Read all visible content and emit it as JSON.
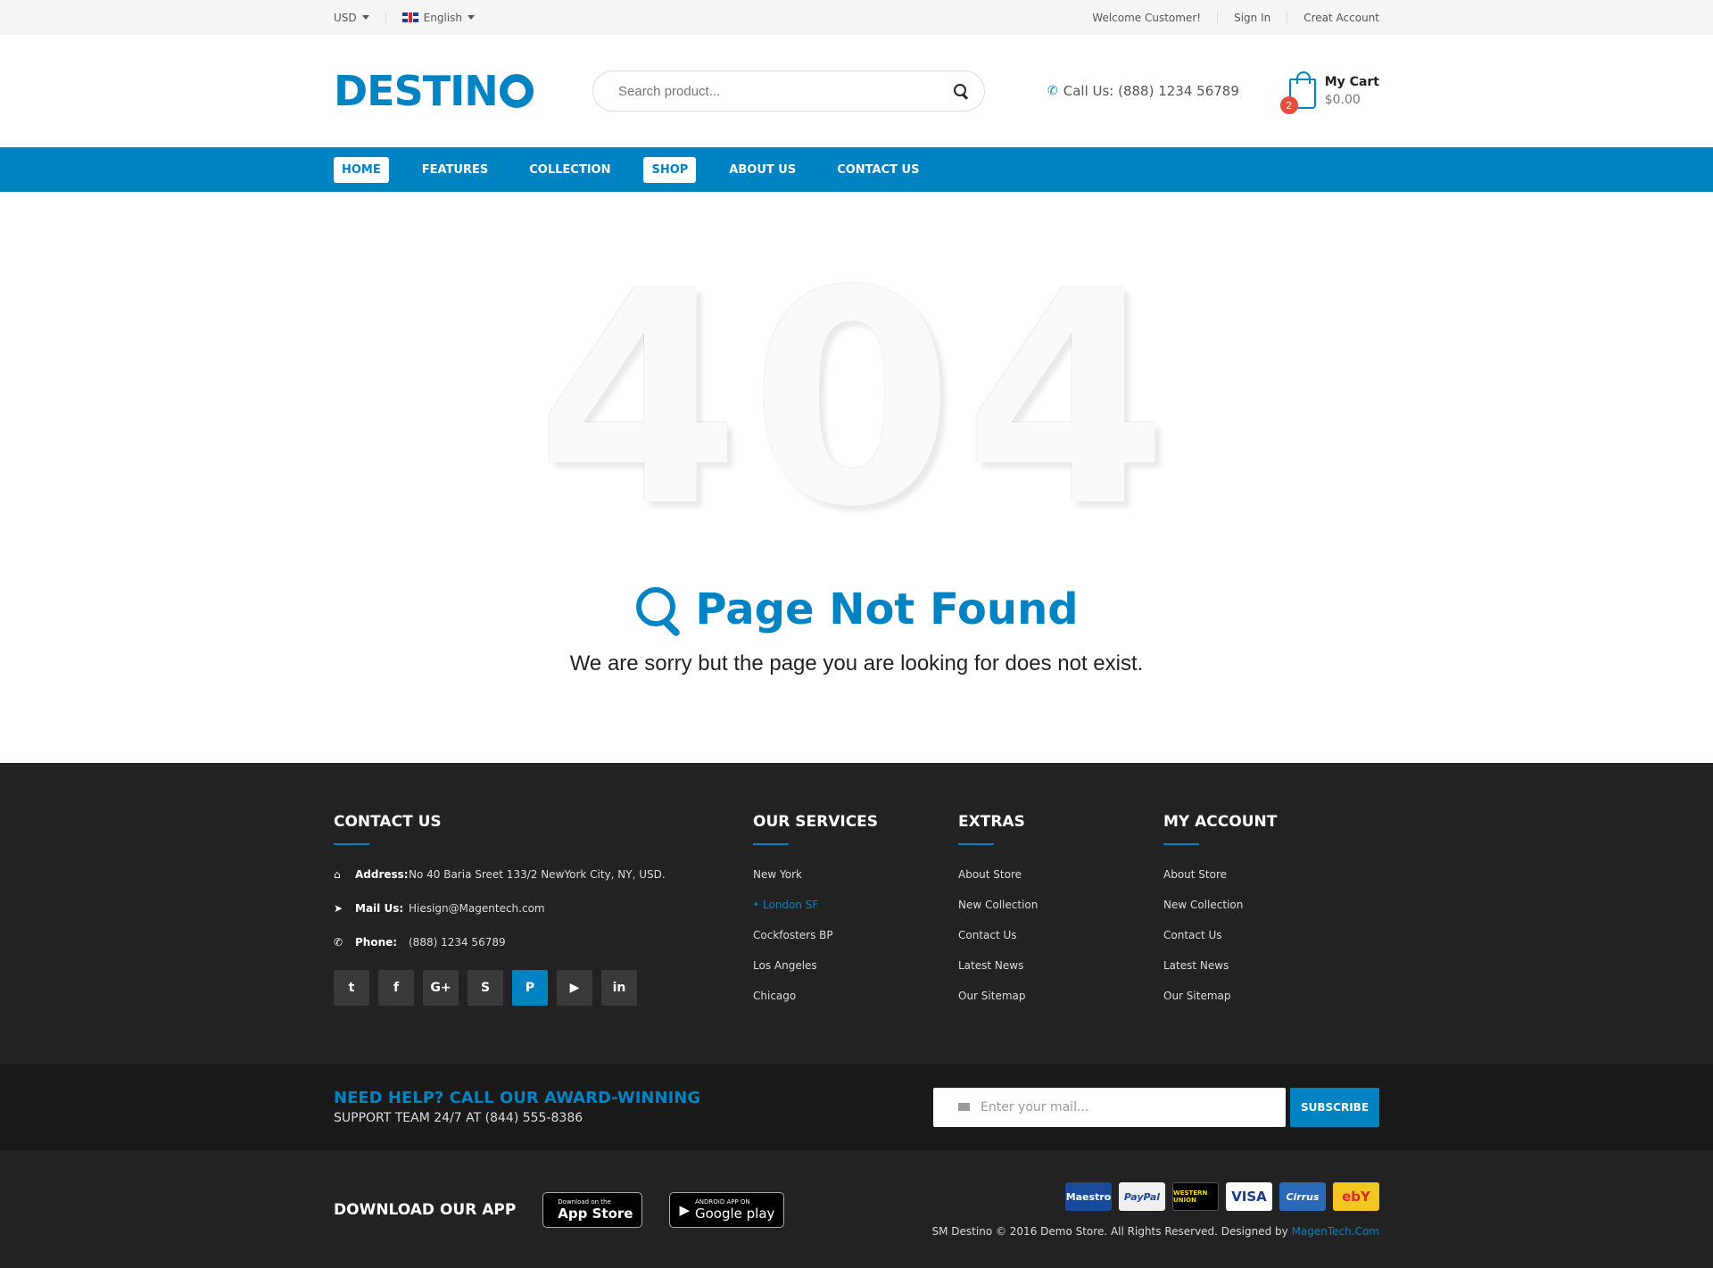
{
  "topbar": {
    "currency": "USD",
    "language": "English",
    "welcome": "Welcome Customer!",
    "sign_in": "Sign In",
    "create_account": "Creat Account"
  },
  "header": {
    "logo": "DESTIN",
    "search_placeholder": "Search product...",
    "call_us": "Call Us: (888) 1234 56789",
    "cart_title": "My Cart",
    "cart_total": "$0.00",
    "cart_count": "2"
  },
  "nav": {
    "items": [
      {
        "label": "HOME"
      },
      {
        "label": "FEATURES"
      },
      {
        "label": "COLLECTION"
      },
      {
        "label": "SHOP"
      },
      {
        "label": "ABOUT US"
      },
      {
        "label": "CONTACT US"
      }
    ]
  },
  "main": {
    "code": "404",
    "title": "Page Not Found",
    "message": "We are sorry but the page you are looking for does not exist."
  },
  "footer": {
    "contact": {
      "heading": "CONTACT US",
      "address_label": "Address:",
      "address": "No 40 Baria Sreet 133/2 NewYork City, NY, USD.",
      "mail_label": "Mail Us:",
      "mail": "Hiesign@Magentech.com",
      "phone_label": "Phone:",
      "phone": "(888) 1234 56789",
      "socials": [
        "twitter-icon",
        "facebook-icon",
        "google-plus-icon",
        "skype-icon",
        "pinterest-icon",
        "youtube-icon",
        "linkedin-icon"
      ]
    },
    "services": {
      "heading": "OUR SERVICES",
      "items": [
        "New York",
        "London SF",
        "Cockfosters BP",
        "Los Angeles",
        "Chicago"
      ]
    },
    "extras": {
      "heading": "EXTRAS",
      "items": [
        "About Store",
        "New Collection",
        "Contact Us",
        "Latest News",
        "Our Sitemap"
      ]
    },
    "account": {
      "heading": "MY ACCOUNT",
      "items": [
        "About Store",
        "New Collection",
        "Contact Us",
        "Latest News",
        "Our Sitemap"
      ]
    },
    "help": {
      "line1": "NEED HELP? CALL OUR AWARD-WINNING",
      "line2": "SUPPORT TEAM 24/7 AT (844) 555-8386",
      "mail_placeholder": "Enter your mail...",
      "subscribe": "SUBSCRIBE"
    },
    "app": {
      "heading": "DOWNLOAD OUR APP",
      "appstore_small": "Download on the",
      "appstore": "App Store",
      "google_small": "ANDROID APP ON",
      "google": "Google play"
    },
    "payments": [
      "Maestro",
      "PayPal",
      "WESTERN UNION",
      "VISA",
      "Cirrus",
      "ebY"
    ],
    "copyright": "SM Destino © 2016 Demo Store. All Rights Reserved. Designed by ",
    "designer": "MagenTech.Com"
  },
  "colors": {
    "accent": "#0083c3",
    "footer_bg": "#222222",
    "badge": "#e74c3c"
  }
}
